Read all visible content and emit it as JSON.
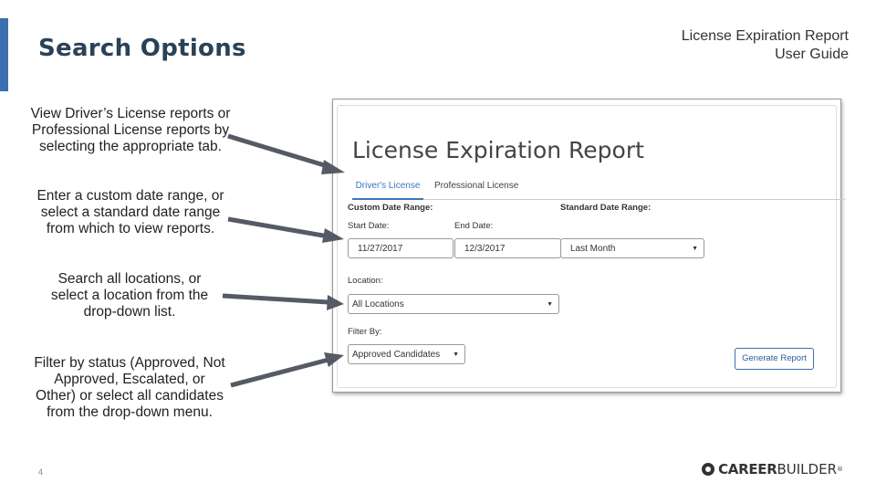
{
  "slide": {
    "title": "Search Options",
    "doc_title_line1": "License Expiration Report",
    "doc_title_line2": "User Guide",
    "page_number": "4"
  },
  "captions": {
    "tabs": "View Driver’s License reports or Professional License reports by selecting the appropriate tab.",
    "dates": "Enter a custom date range, or select a standard date range from which to view reports.",
    "location": "Search all locations, or select a location from the drop-down list.",
    "filter": "Filter by status (Approved, Not Approved, Escalated, or Other) or select all candidates from the drop-down menu."
  },
  "logo": {
    "name_bold": "CAREER",
    "name_light": "BUILDER",
    "reg": "®"
  },
  "report": {
    "title": "License Expiration Report",
    "tabs": [
      {
        "label": "Driver's License",
        "active": true
      },
      {
        "label": "Professional License",
        "active": false
      }
    ],
    "custom_range_label": "Custom Date Range:",
    "standard_range_label": "Standard Date Range:",
    "start_label": "Start Date:",
    "end_label": "End Date:",
    "start_value": "11/27/2017",
    "end_value": "12/3/2017",
    "standard_value": "Last Month",
    "location_label": "Location:",
    "location_value": "All Locations",
    "filter_label": "Filter By:",
    "filter_value": "Approved Candidates",
    "generate_button": "Generate Report"
  },
  "colors": {
    "accent": "#3a6fb0",
    "title": "#2a4257",
    "arrow": "#555a66",
    "active_tab": "#3a78b8"
  },
  "icons": {
    "dropdown": "caret-down-icon",
    "logo": "careerbuilder-logo-icon"
  }
}
